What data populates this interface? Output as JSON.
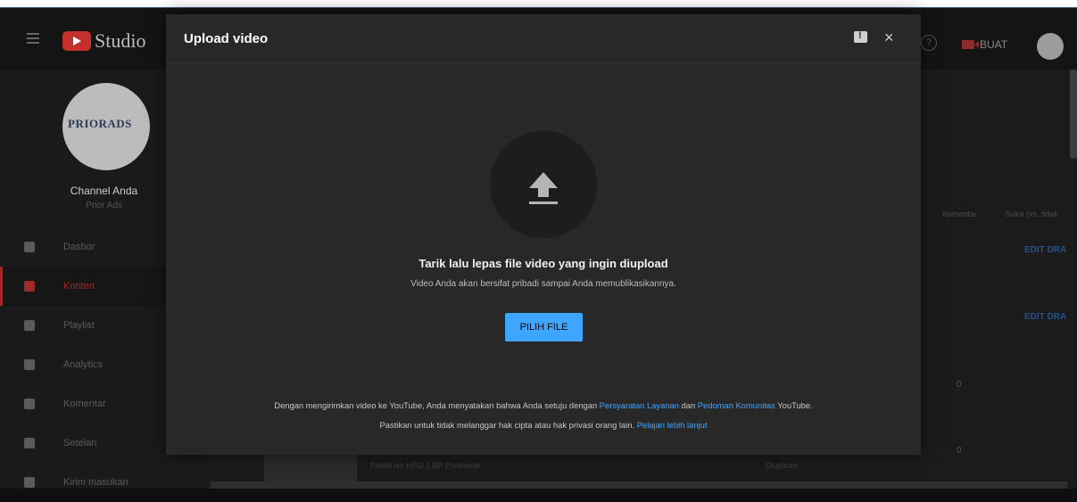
{
  "app": {
    "logo_text": "Studio",
    "create_label": "BUAT",
    "help_icon_glyph": "?",
    "brand_color": "#c4302b",
    "accent_color": "#3ea6ff"
  },
  "sidebar": {
    "avatar_brand": "PRIORADS",
    "channel_title": "Channel Anda",
    "channel_name": "Prior Ads",
    "items": [
      {
        "label": "Dasbor",
        "icon": "dashboard-icon",
        "active": false
      },
      {
        "label": "Konten",
        "icon": "content-icon",
        "active": true
      },
      {
        "label": "Playlist",
        "icon": "playlist-icon",
        "active": false
      },
      {
        "label": "Analytics",
        "icon": "analytics-icon",
        "active": false
      },
      {
        "label": "Komentar",
        "icon": "comments-icon",
        "active": false
      },
      {
        "label": "Setelan",
        "icon": "settings-icon",
        "active": false
      },
      {
        "label": "Kirim masukan",
        "icon": "feedback-icon",
        "active": false
      }
    ]
  },
  "background_table": {
    "header_comments": "Komentar",
    "header_likes": "Suka (vs. tidak",
    "edit_label": "EDIT DRA",
    "comments_count_1": "0",
    "comments_count_2": "0",
    "row_title": "Pelatihan HRD 1 BP Pontianak",
    "row_status": "Diupload"
  },
  "dialog": {
    "title": "Upload video",
    "drag_title": "Tarik lalu lepas file video yang ingin diupload",
    "drag_subtitle": "Video Anda akan bersifat pribadi sampai Anda memublikasikannya.",
    "pick_button": "PILIH FILE",
    "close_glyph": "×",
    "terms_prefix": "Dengan mengirimkan video ke YouTube, Anda menyatakan bahwa Anda setuju dengan ",
    "terms_link1": "Persyaratan Layanan",
    "terms_mid": " dan ",
    "terms_link2": "Pedoman Komunitas",
    "terms_suffix": " YouTube.",
    "privacy_prefix": "Pastikan untuk tidak melanggar hak cipta atau hak privasi orang lain. ",
    "privacy_link": "Pelajari lebih lanjut"
  }
}
